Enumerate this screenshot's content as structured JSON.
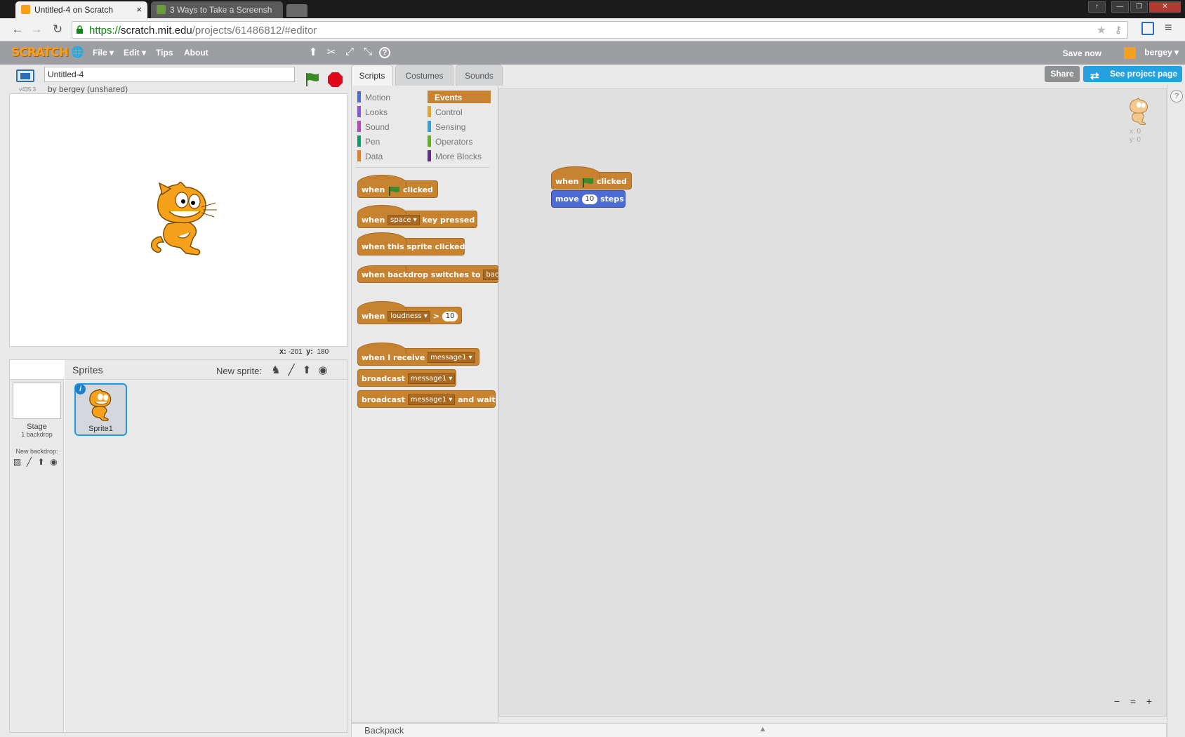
{
  "browser": {
    "tabs": [
      {
        "title": "Untitled-4 on Scratch",
        "close": "×"
      },
      {
        "title": "3 Ways to Take a Screensh"
      }
    ],
    "url_scheme": "https://",
    "url_host": "scratch.mit.edu",
    "url_path": "/projects/61486812/#editor",
    "window_controls": [
      "↑",
      "—",
      "❐",
      "✕"
    ]
  },
  "menubar": {
    "logo": "SCRATCH",
    "items": [
      "File ▾",
      "Edit ▾",
      "Tips",
      "About"
    ],
    "save_now": "Save now",
    "username": "bergey ▾"
  },
  "stage": {
    "version": "v435.3",
    "title": "Untitled-4",
    "byline": "by bergey (unshared)",
    "coords": {
      "x_label": "x:",
      "x": "-201",
      "y_label": "y:",
      "y": "180"
    }
  },
  "sprites_pane": {
    "title": "Sprites",
    "new_sprite": "New sprite:",
    "stage_label": "Stage",
    "backdrop_count": "1 backdrop",
    "new_backdrop": "New backdrop:",
    "sprite_name": "Sprite1",
    "info": "i"
  },
  "palette_tabs": [
    "Scripts",
    "Costumes",
    "Sounds"
  ],
  "categories": {
    "left": [
      {
        "label": "Motion",
        "color": "#4a6cd4"
      },
      {
        "label": "Looks",
        "color": "#8a55d7"
      },
      {
        "label": "Sound",
        "color": "#bb42c3"
      },
      {
        "label": "Pen",
        "color": "#0e9a6c"
      },
      {
        "label": "Data",
        "color": "#ee7d16"
      }
    ],
    "right": [
      {
        "label": "Events",
        "color": "#c88330",
        "selected": true
      },
      {
        "label": "Control",
        "color": "#e1a91a"
      },
      {
        "label": "Sensing",
        "color": "#2ca5e2"
      },
      {
        "label": "Operators",
        "color": "#5cb712"
      },
      {
        "label": "More Blocks",
        "color": "#632d99"
      }
    ]
  },
  "blocks": {
    "b1": {
      "a": "when",
      "b": "clicked"
    },
    "b2": {
      "a": "when",
      "dd": "space",
      "b": "key pressed"
    },
    "b3": {
      "a": "when this sprite clicked"
    },
    "b4": {
      "a": "when backdrop switches to",
      "dd": "backd"
    },
    "b5": {
      "a": "when",
      "dd": "loudness",
      "op": ">",
      "num": "10"
    },
    "b6": {
      "a": "when I receive",
      "dd": "message1"
    },
    "b7": {
      "a": "broadcast",
      "dd": "message1"
    },
    "b8": {
      "a": "broadcast",
      "dd": "message1",
      "b": "and wait"
    }
  },
  "script": {
    "hat": {
      "a": "when",
      "b": "clicked"
    },
    "move": {
      "a": "move",
      "num": "10",
      "b": "steps"
    }
  },
  "topright": {
    "share": "Share",
    "see_project": "See project page",
    "help": "?"
  },
  "sprite_info": {
    "x": "x: 0",
    "y": "y: 0"
  },
  "zoom": [
    "−",
    "=",
    "+"
  ],
  "backpack": {
    "label": "Backpack",
    "arrow": "▲"
  },
  "colors": {
    "events": "#c88330",
    "motion_block": "#4a6cd4",
    "menubar": "#9c9ea2",
    "accent": "#25a1e0"
  }
}
